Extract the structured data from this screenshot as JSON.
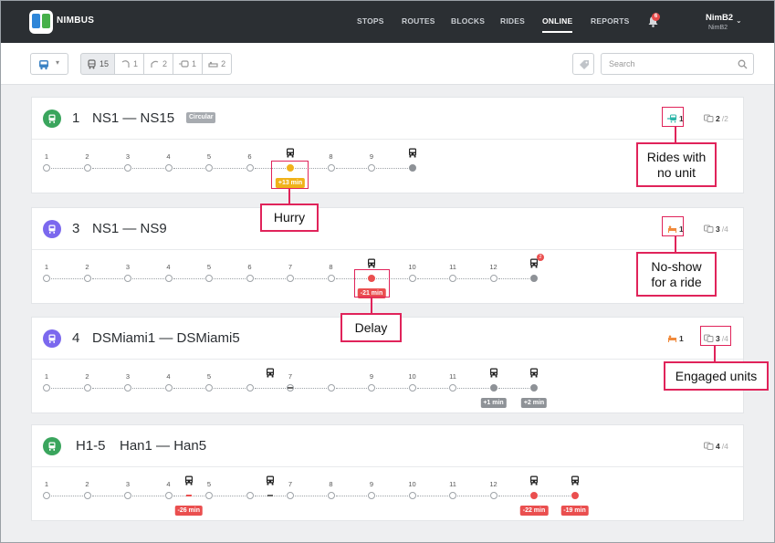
{
  "app": {
    "brand": "NIMBUS"
  },
  "nav": {
    "menu": [
      "STOPS",
      "ROUTES",
      "BLOCKS",
      "RIDES",
      "ONLINE",
      "REPORTS"
    ],
    "active": "ONLINE",
    "notifications": "6",
    "user": {
      "name": "NimB2",
      "sub": "NimB2"
    }
  },
  "toolbar": {
    "filters": [
      {
        "icon": "bus-icon",
        "count": "15"
      },
      {
        "icon": "route-off-icon",
        "count": "1"
      },
      {
        "icon": "route-late-icon",
        "count": "2"
      },
      {
        "icon": "bus-arrow-icon",
        "count": "1"
      },
      {
        "icon": "bed-icon",
        "count": "2"
      }
    ],
    "search_placeholder": "Search"
  },
  "routes": [
    {
      "icon_color": "#3aa55d",
      "number": "1",
      "title": "NS1 — NS15",
      "badge": "Circular",
      "stats": [
        {
          "icon": "bus-arrow-icon",
          "color": "#2bb5a8",
          "value": "1",
          "total": ""
        },
        {
          "icon": "units-icon",
          "color": "#999",
          "value": "2",
          "total": "/2"
        }
      ],
      "stops": [
        "1",
        "2",
        "3",
        "4",
        "5",
        "6",
        "",
        "8",
        "9",
        ""
      ],
      "badges": [
        "+13 min"
      ]
    },
    {
      "icon_color": "#7b68ee",
      "number": "3",
      "title": "NS1 — NS9",
      "stats": [
        {
          "icon": "bed-icon",
          "color": "#f08a3c",
          "value": "1",
          "total": ""
        },
        {
          "icon": "units-icon",
          "color": "#999",
          "value": "3",
          "total": "/4"
        }
      ],
      "stops": [
        "1",
        "2",
        "3",
        "4",
        "5",
        "6",
        "7",
        "8",
        "",
        "10",
        "11",
        "12",
        ""
      ],
      "badges": [
        "-21 min"
      ],
      "bus_badge": "2"
    },
    {
      "icon_color": "#7b68ee",
      "number": "4",
      "title": "DSMiami1 — DSMiami5",
      "stats": [
        {
          "icon": "bed-icon",
          "color": "#f08a3c",
          "value": "1",
          "total": ""
        },
        {
          "icon": "units-icon",
          "color": "#999",
          "value": "3",
          "total": "/4"
        }
      ],
      "stops": [
        "1",
        "2",
        "3",
        "4",
        "5",
        "",
        "7",
        "",
        "9",
        "10",
        "11",
        "",
        ""
      ],
      "badges": [
        "+1 min",
        "+2 min"
      ]
    },
    {
      "icon_color": "#3aa55d",
      "number": "H1-5",
      "title": "Han1 — Han5",
      "stats": [
        {
          "icon": "units-icon",
          "color": "#999",
          "value": "4",
          "total": "/4"
        }
      ],
      "stops": [
        "1",
        "2",
        "3",
        "4",
        "5",
        "",
        "7",
        "8",
        "9",
        "10",
        "11",
        "12",
        "",
        ""
      ],
      "badges": [
        "-26 min",
        "-22 min",
        "-19 min"
      ]
    }
  ],
  "callouts": {
    "rides_no_unit": "Rides with\nno unit",
    "hurry": "Hurry",
    "no_show": "No-show\nfor a ride",
    "delay": "Delay",
    "engaged": "Engaged units"
  }
}
